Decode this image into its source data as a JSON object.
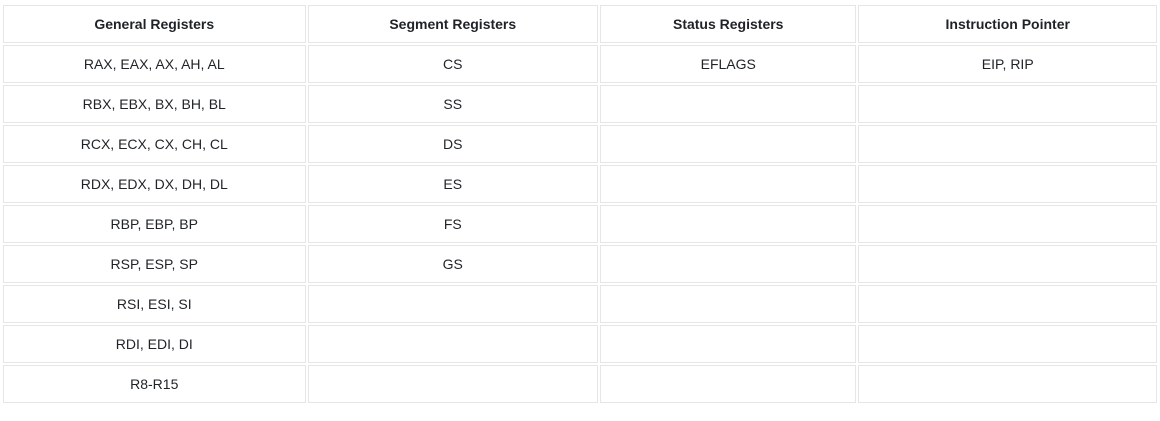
{
  "table": {
    "headers": [
      "General Registers",
      "Segment Registers",
      "Status Registers",
      "Instruction Pointer"
    ],
    "rows": [
      [
        "RAX, EAX, AX, AH, AL",
        "CS",
        "EFLAGS",
        "EIP, RIP"
      ],
      [
        "RBX, EBX, BX, BH, BL",
        "SS",
        "",
        ""
      ],
      [
        "RCX, ECX, CX, CH, CL",
        "DS",
        "",
        ""
      ],
      [
        "RDX, EDX, DX, DH, DL",
        "ES",
        "",
        ""
      ],
      [
        "RBP, EBP, BP",
        "FS",
        "",
        ""
      ],
      [
        "RSP, ESP, SP",
        "GS",
        "",
        ""
      ],
      [
        "RSI, ESI, SI",
        "",
        "",
        ""
      ],
      [
        "RDI, EDI, DI",
        "",
        "",
        ""
      ],
      [
        "R8-R15",
        "",
        "",
        ""
      ]
    ]
  }
}
